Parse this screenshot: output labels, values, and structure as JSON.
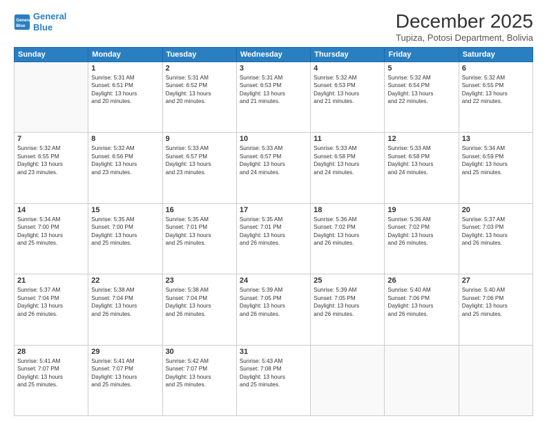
{
  "logo": {
    "line1": "General",
    "line2": "Blue"
  },
  "header": {
    "month_year": "December 2025",
    "location": "Tupiza, Potosi Department, Bolivia"
  },
  "days_of_week": [
    "Sunday",
    "Monday",
    "Tuesday",
    "Wednesday",
    "Thursday",
    "Friday",
    "Saturday"
  ],
  "weeks": [
    [
      {
        "day": "",
        "info": ""
      },
      {
        "day": "1",
        "info": "Sunrise: 5:31 AM\nSunset: 6:51 PM\nDaylight: 13 hours\nand 20 minutes."
      },
      {
        "day": "2",
        "info": "Sunrise: 5:31 AM\nSunset: 6:52 PM\nDaylight: 13 hours\nand 20 minutes."
      },
      {
        "day": "3",
        "info": "Sunrise: 5:31 AM\nSunset: 6:53 PM\nDaylight: 13 hours\nand 21 minutes."
      },
      {
        "day": "4",
        "info": "Sunrise: 5:32 AM\nSunset: 6:53 PM\nDaylight: 13 hours\nand 21 minutes."
      },
      {
        "day": "5",
        "info": "Sunrise: 5:32 AM\nSunset: 6:54 PM\nDaylight: 13 hours\nand 22 minutes."
      },
      {
        "day": "6",
        "info": "Sunrise: 5:32 AM\nSunset: 6:55 PM\nDaylight: 13 hours\nand 22 minutes."
      }
    ],
    [
      {
        "day": "7",
        "info": "Sunrise: 5:32 AM\nSunset: 6:55 PM\nDaylight: 13 hours\nand 23 minutes."
      },
      {
        "day": "8",
        "info": "Sunrise: 5:32 AM\nSunset: 6:56 PM\nDaylight: 13 hours\nand 23 minutes."
      },
      {
        "day": "9",
        "info": "Sunrise: 5:33 AM\nSunset: 6:57 PM\nDaylight: 13 hours\nand 23 minutes."
      },
      {
        "day": "10",
        "info": "Sunrise: 5:33 AM\nSunset: 6:57 PM\nDaylight: 13 hours\nand 24 minutes."
      },
      {
        "day": "11",
        "info": "Sunrise: 5:33 AM\nSunset: 6:58 PM\nDaylight: 13 hours\nand 24 minutes."
      },
      {
        "day": "12",
        "info": "Sunrise: 5:33 AM\nSunset: 6:58 PM\nDaylight: 13 hours\nand 24 minutes."
      },
      {
        "day": "13",
        "info": "Sunrise: 5:34 AM\nSunset: 6:59 PM\nDaylight: 13 hours\nand 25 minutes."
      }
    ],
    [
      {
        "day": "14",
        "info": "Sunrise: 5:34 AM\nSunset: 7:00 PM\nDaylight: 13 hours\nand 25 minutes."
      },
      {
        "day": "15",
        "info": "Sunrise: 5:35 AM\nSunset: 7:00 PM\nDaylight: 13 hours\nand 25 minutes."
      },
      {
        "day": "16",
        "info": "Sunrise: 5:35 AM\nSunset: 7:01 PM\nDaylight: 13 hours\nand 25 minutes."
      },
      {
        "day": "17",
        "info": "Sunrise: 5:35 AM\nSunset: 7:01 PM\nDaylight: 13 hours\nand 26 minutes."
      },
      {
        "day": "18",
        "info": "Sunrise: 5:36 AM\nSunset: 7:02 PM\nDaylight: 13 hours\nand 26 minutes."
      },
      {
        "day": "19",
        "info": "Sunrise: 5:36 AM\nSunset: 7:02 PM\nDaylight: 13 hours\nand 26 minutes."
      },
      {
        "day": "20",
        "info": "Sunrise: 5:37 AM\nSunset: 7:03 PM\nDaylight: 13 hours\nand 26 minutes."
      }
    ],
    [
      {
        "day": "21",
        "info": "Sunrise: 5:37 AM\nSunset: 7:04 PM\nDaylight: 13 hours\nand 26 minutes."
      },
      {
        "day": "22",
        "info": "Sunrise: 5:38 AM\nSunset: 7:04 PM\nDaylight: 13 hours\nand 26 minutes."
      },
      {
        "day": "23",
        "info": "Sunrise: 5:38 AM\nSunset: 7:04 PM\nDaylight: 13 hours\nand 26 minutes."
      },
      {
        "day": "24",
        "info": "Sunrise: 5:39 AM\nSunset: 7:05 PM\nDaylight: 13 hours\nand 26 minutes."
      },
      {
        "day": "25",
        "info": "Sunrise: 5:39 AM\nSunset: 7:05 PM\nDaylight: 13 hours\nand 26 minutes."
      },
      {
        "day": "26",
        "info": "Sunrise: 5:40 AM\nSunset: 7:06 PM\nDaylight: 13 hours\nand 26 minutes."
      },
      {
        "day": "27",
        "info": "Sunrise: 5:40 AM\nSunset: 7:06 PM\nDaylight: 13 hours\nand 25 minutes."
      }
    ],
    [
      {
        "day": "28",
        "info": "Sunrise: 5:41 AM\nSunset: 7:07 PM\nDaylight: 13 hours\nand 25 minutes."
      },
      {
        "day": "29",
        "info": "Sunrise: 5:41 AM\nSunset: 7:07 PM\nDaylight: 13 hours\nand 25 minutes."
      },
      {
        "day": "30",
        "info": "Sunrise: 5:42 AM\nSunset: 7:07 PM\nDaylight: 13 hours\nand 25 minutes."
      },
      {
        "day": "31",
        "info": "Sunrise: 5:43 AM\nSunset: 7:08 PM\nDaylight: 13 hours\nand 25 minutes."
      },
      {
        "day": "",
        "info": ""
      },
      {
        "day": "",
        "info": ""
      },
      {
        "day": "",
        "info": ""
      }
    ]
  ]
}
